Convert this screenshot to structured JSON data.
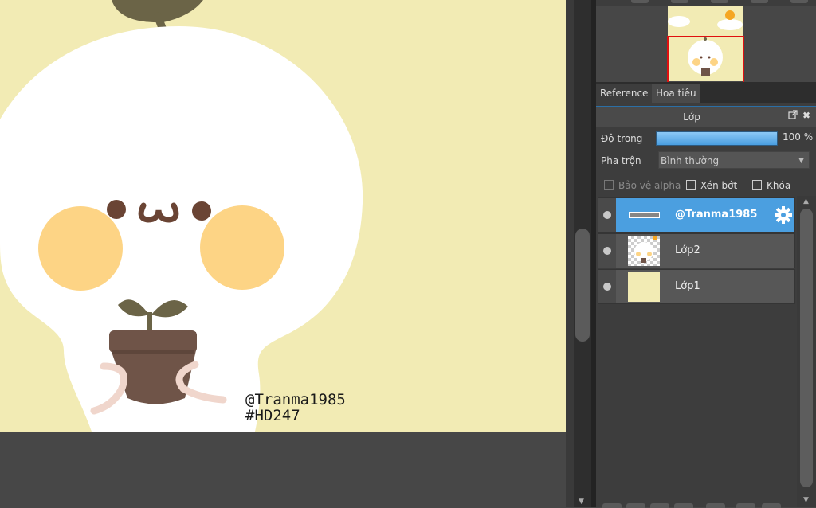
{
  "canvas": {
    "background_color": "#f2ebb4",
    "watermark_line1": "@Tranma1985",
    "watermark_line2": "#HD247"
  },
  "panel_tabs": {
    "reference": "Reference",
    "navigator": "Hoa tiêu"
  },
  "layer_panel": {
    "title": "Lớp",
    "opacity_label": "Độ trong",
    "opacity_value": "100 %",
    "opacity_percent": 100,
    "blend_label": "Pha trộn",
    "blend_value": "Bình thường",
    "protect_alpha": "Bảo vệ alpha",
    "clipping": "Xén bớt",
    "lock": "Khóa",
    "layers": [
      {
        "name": "@Tranma1985",
        "selected": true,
        "visible": true
      },
      {
        "name": "Lớp2",
        "selected": false,
        "visible": true
      },
      {
        "name": "Lớp1",
        "selected": false,
        "visible": true
      }
    ]
  },
  "colors": {
    "selected_layer": "#4b9fe0",
    "panel_bg": "#3d3d3d",
    "canvas_bg": "#f2ebb4",
    "cheek": "#fdd485",
    "pot": "#6f5448",
    "sprout": "#6b6447"
  }
}
